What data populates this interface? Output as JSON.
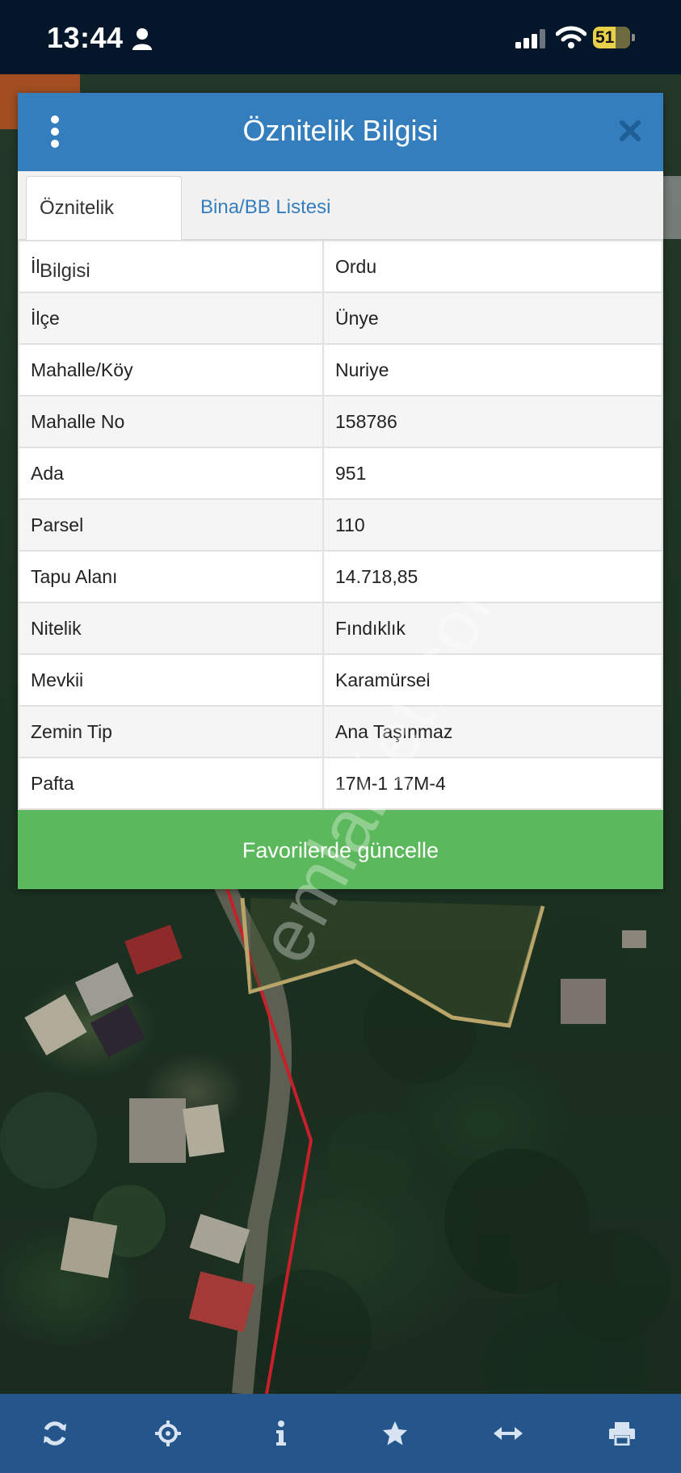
{
  "status_bar": {
    "time": "13:44",
    "battery": "51"
  },
  "panel": {
    "title": "Öznitelik Bilgisi",
    "tabs": [
      {
        "label": "Öznitelik Bilgisi",
        "active": true
      },
      {
        "label": "Bina/BB Listesi",
        "active": false
      }
    ],
    "rows": [
      {
        "key": "İl",
        "value": "Ordu"
      },
      {
        "key": "İlçe",
        "value": "Ünye"
      },
      {
        "key": "Mahalle/Köy",
        "value": "Nuriye"
      },
      {
        "key": "Mahalle No",
        "value": "158786"
      },
      {
        "key": "Ada",
        "value": "951"
      },
      {
        "key": "Parsel",
        "value": "110"
      },
      {
        "key": "Tapu Alanı",
        "value": "14.718,85"
      },
      {
        "key": "Nitelik",
        "value": "Fındıklık"
      },
      {
        "key": "Mevkii",
        "value": "Karamürsel"
      },
      {
        "key": "Zemin Tip",
        "value": "Ana Taşınmaz"
      },
      {
        "key": "Pafta",
        "value": "17M-1 17M-4"
      }
    ],
    "update_button": "Favorilerde güncelle"
  },
  "watermark": "emlakjet.com",
  "toolbar": {
    "buttons": [
      "refresh-icon",
      "crosshair-icon",
      "info-icon",
      "star-icon",
      "measure-icon",
      "print-icon"
    ]
  },
  "colors": {
    "header_blue": "#357ebd",
    "tab_link_blue": "#357ebd",
    "button_green": "#5cb85c",
    "toolbar_blue": "#24568c",
    "status_bar": "#04172a",
    "battery_yellow": "#e8d04a",
    "road_red": "#c8202a",
    "parcel_outline": "#b9a46a"
  }
}
